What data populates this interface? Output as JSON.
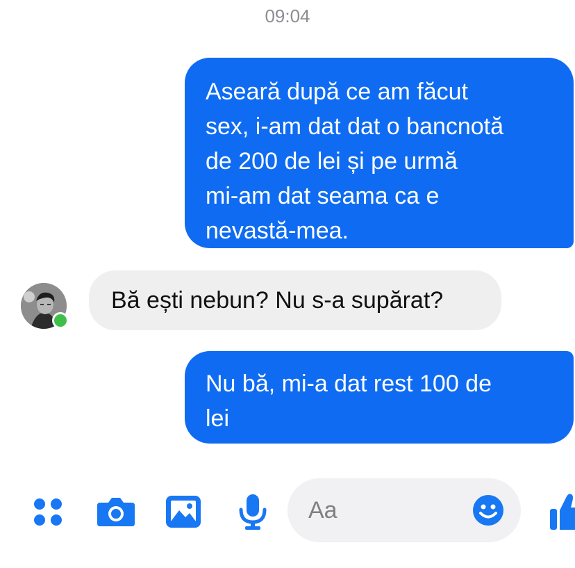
{
  "conversation": {
    "timestamp": "09:04",
    "messages": [
      {
        "direction": "sent",
        "lines": [
          "Aseară după ce am făcut",
          "sex, i-am dat dat o bancnotă",
          "de 200 de lei și pe urmă",
          "mi-am dat seama ca e",
          "nevastă-mea."
        ]
      },
      {
        "direction": "received",
        "lines": [
          "Bă ești nebun? Nu s-a supărat?"
        ]
      },
      {
        "direction": "sent",
        "lines": [
          "Nu bă, mi-a dat rest 100 de",
          "lei"
        ]
      }
    ]
  },
  "composer": {
    "placeholder": "Aa",
    "icons": [
      "apps-icon",
      "camera-icon",
      "gallery-icon",
      "microphone-icon",
      "emoji-icon",
      "thumbs-up-icon"
    ]
  },
  "colors": {
    "sent_bubble": "#0f6cf2",
    "received_bubble": "#efefef",
    "accent": "#1877f2",
    "online_status": "#3fbf4a"
  }
}
